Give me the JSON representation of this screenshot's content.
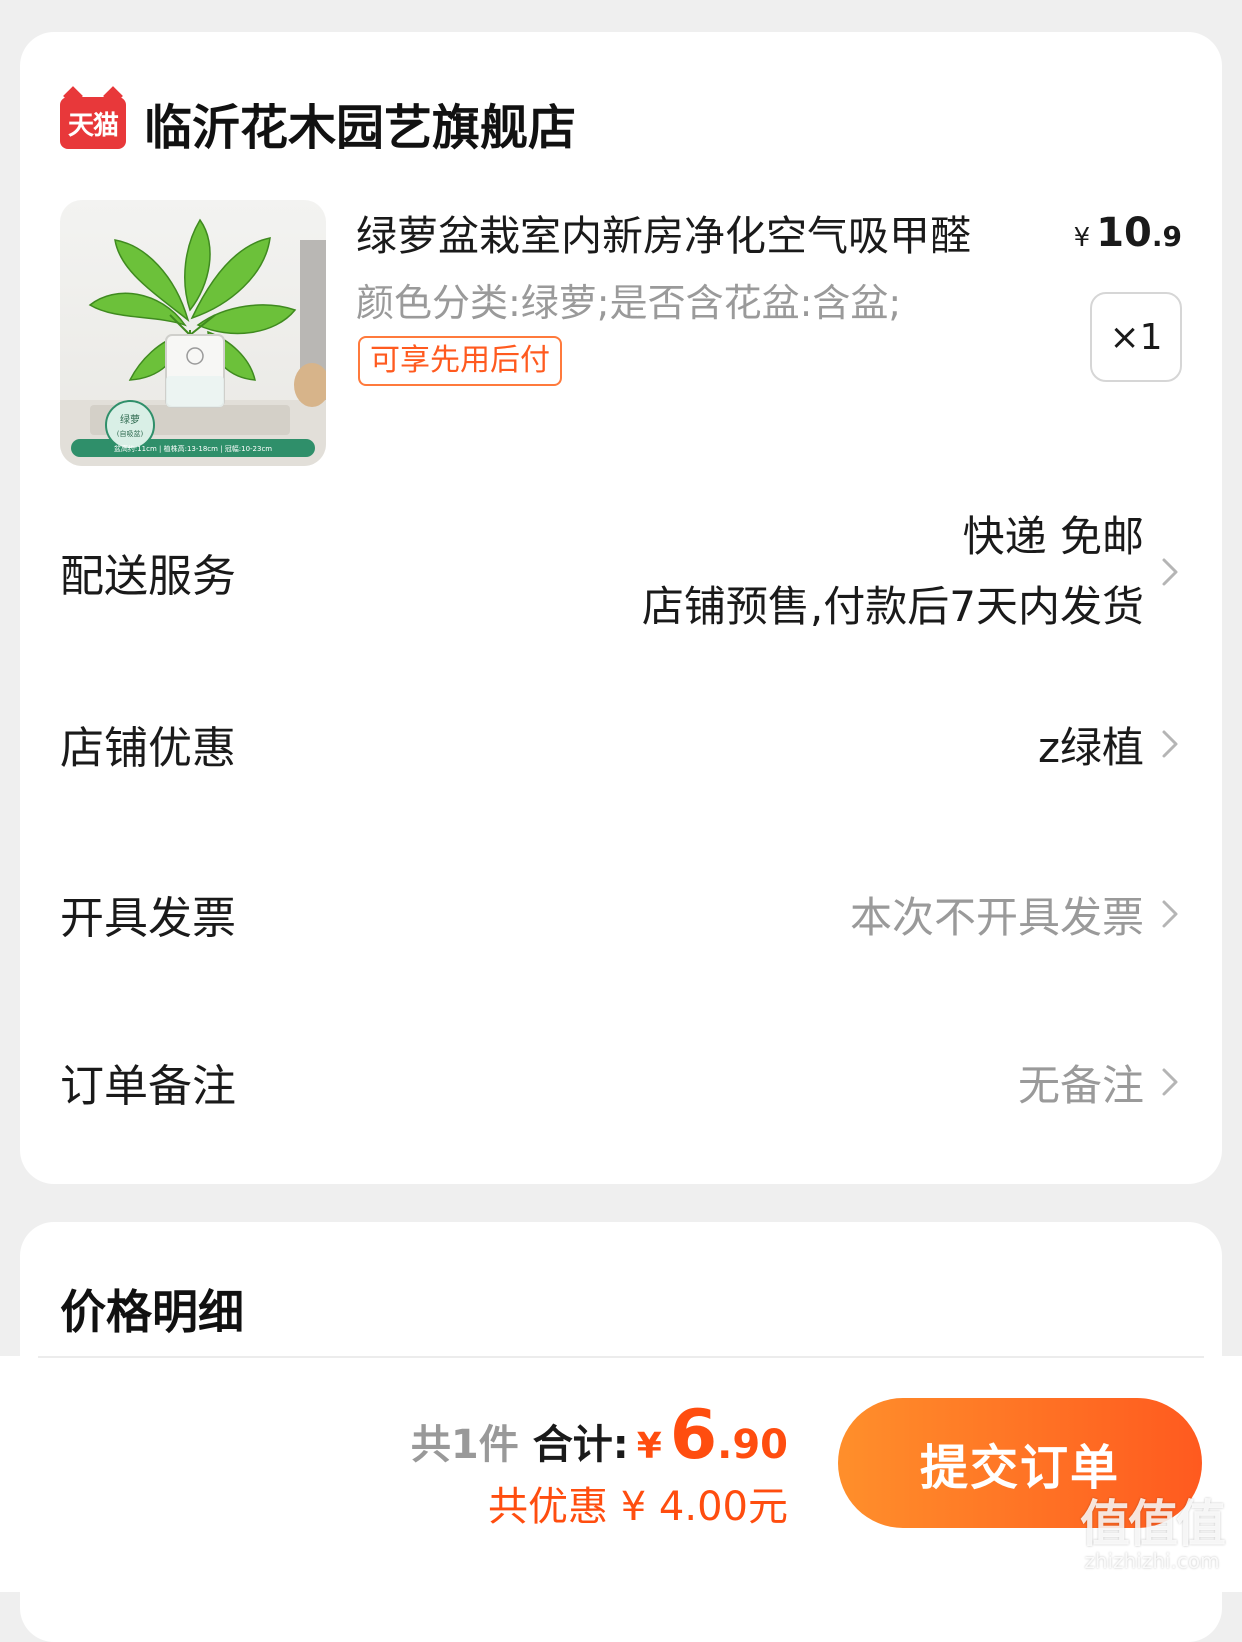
{
  "store": {
    "badge": "天猫",
    "name": "临沂花木园艺旗舰店"
  },
  "product": {
    "title": "绿萝盆栽室内新房净化空气吸甲醛",
    "spec": "颜色分类:绿萝;是否含花盆:含盆;",
    "tag": "可享先用后付",
    "price_currency": "¥",
    "price_int": "10",
    "price_dec": ".9",
    "quantity": "×1",
    "image_labels": {
      "name": "绿萝",
      "sub": "(自吸盆)",
      "specs": "盆高约:11cm | 植株高:13-18cm | 冠幅:10-23cm"
    }
  },
  "rows": {
    "delivery": {
      "label": "配送服务",
      "line1": "快递 免邮",
      "line2": "店铺预售,付款后7天内发货"
    },
    "coupon": {
      "label": "店铺优惠",
      "value": "z绿植"
    },
    "invoice": {
      "label": "开具发票",
      "value": "本次不开具发票"
    },
    "note": {
      "label": "订单备注",
      "value": "无备注"
    }
  },
  "price_detail": {
    "title": "价格明细"
  },
  "bottom": {
    "count": "共1件",
    "total_label": "合计:",
    "currency": "¥",
    "total_int": "6",
    "total_dec": ".90",
    "discount": "共优惠 ¥ 4.00元",
    "submit": "提交订单"
  },
  "watermark": {
    "big": "值值值",
    "small": "zhizhizhi.com"
  },
  "colors": {
    "accent": "#ff4d0f",
    "button_start": "#ff8f2b",
    "button_end": "#ff5a1f",
    "tmall_red": "#e8383a"
  }
}
